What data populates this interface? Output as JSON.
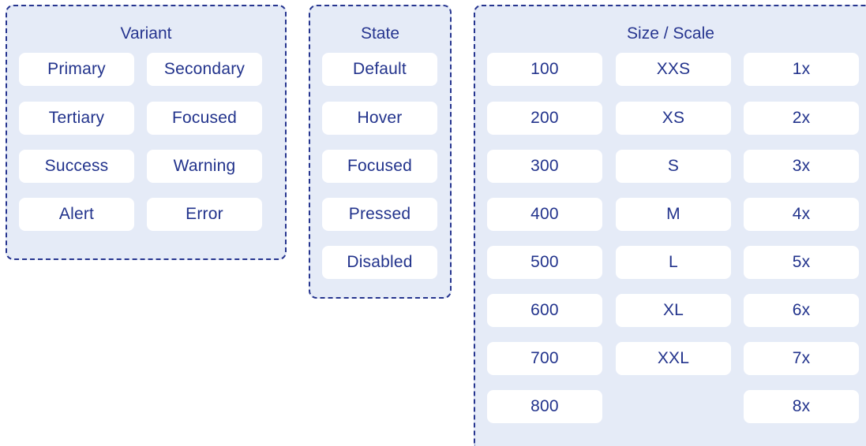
{
  "variant": {
    "title": "Variant",
    "items": [
      "Primary",
      "Secondary",
      "Tertiary",
      "Focused",
      "Success",
      "Warning",
      "Alert",
      "Error"
    ]
  },
  "state": {
    "title": "State",
    "items": [
      "Default",
      "Hover",
      "Focused",
      "Pressed",
      "Disabled"
    ]
  },
  "size": {
    "title": "Size / Scale",
    "weights": [
      "100",
      "200",
      "300",
      "400",
      "500",
      "600",
      "700",
      "800"
    ],
    "sizes": [
      "XXS",
      "XS",
      "S",
      "M",
      "L",
      "XL",
      "XXL"
    ],
    "scales": [
      "1x",
      "2x",
      "3x",
      "4x",
      "5x",
      "6x",
      "7x",
      "8x"
    ]
  },
  "colors": {
    "panel_bg": "#e5ebf7",
    "border": "#26358f",
    "text": "#22338c",
    "chip_bg": "#ffffff"
  }
}
